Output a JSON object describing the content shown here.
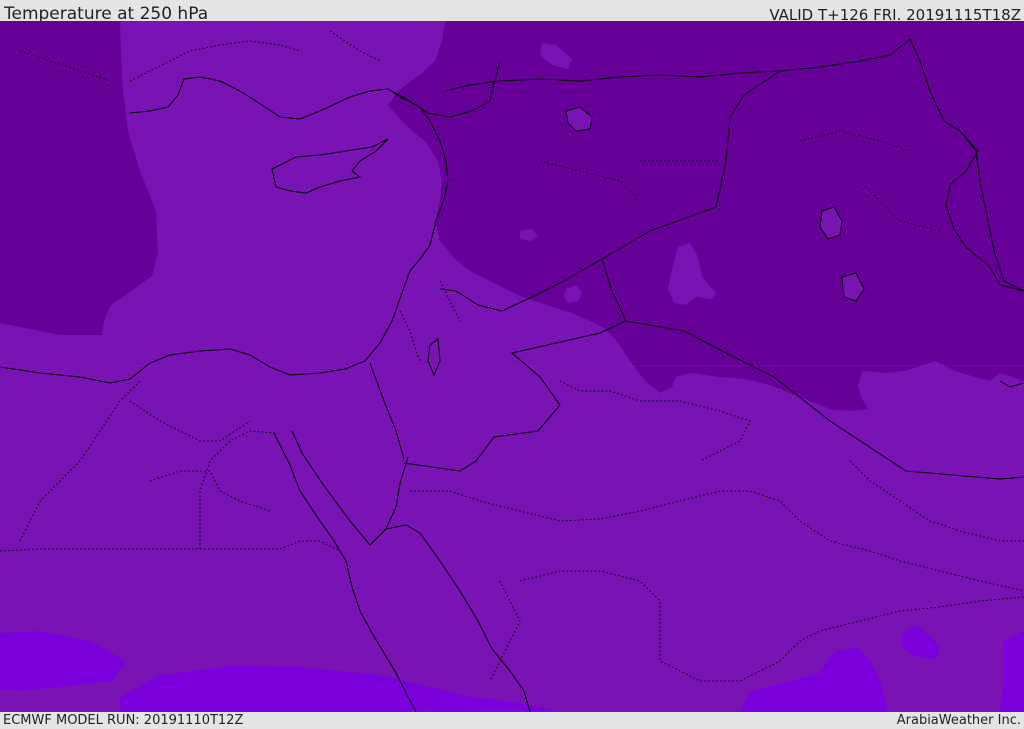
{
  "header": {
    "title": "Temperature at 250 hPa",
    "valid": "VALID T+126 FRI. 20191115T18Z"
  },
  "footer": {
    "model_run": "ECMWF MODEL RUN: 20191110T12Z",
    "credit": "ArabiaWeather Inc."
  },
  "colors": {
    "base_band": "#7a13b4",
    "cold_band": "#660099",
    "warm_band": "#7b00dd",
    "borders": "#000000",
    "frame": "#e4e4e4"
  }
}
